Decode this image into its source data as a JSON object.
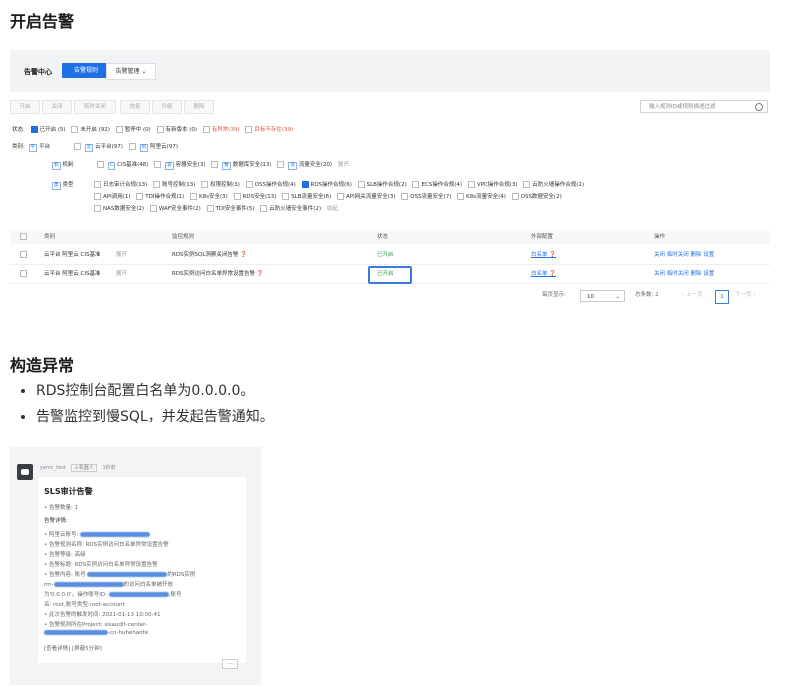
{
  "section1_title": "开启告警",
  "section2_title": "构造异常",
  "bullets": [
    "RDS控制台配置白名单为0.0.0.0。",
    "告警监控到慢SQL，并发起告警通知。"
  ],
  "console": {
    "title": "告警中心",
    "tab_rules": "告警规则",
    "tab_manage": "告警管理",
    "buttons": [
      "开启",
      "关闭",
      "临时关闭",
      "恢复",
      "升级",
      "删除"
    ],
    "search_placeholder": "输入规则ID或规则描述过滤",
    "status_label": "状态:",
    "status_items": [
      "已开启 (5)",
      "未开启 (92)",
      "暂停中 (0)",
      "有新版本 (0)"
    ],
    "status_red": [
      "有异常(39)",
      "目标不存在(39)"
    ],
    "cat_label": "类别:",
    "platform_label": "平台",
    "platform_items": [
      "云平台(97)",
      "阿里云(97)"
    ],
    "mech_label": "机制",
    "mech_items": [
      "CIS基准(48)",
      "容器安全(3)",
      "数据库安全(13)",
      "流量安全(20)"
    ],
    "mech_more": "展开",
    "type_label": "类型",
    "type_row1": [
      "日志审计合规(13)",
      "账号控制(13)",
      "权限控制(3)",
      "OSS操作合规(4)",
      "RDS操作合规(6)",
      "SLB操作合规(2)",
      "ECS操作合规(4)",
      "VPC操作合规(3)",
      "云防火墙操作合规(1)"
    ],
    "type_row2": [
      "API调用(1)",
      "TDI操作合规(1)",
      "K8s安全(3)",
      "RDS安全(13)",
      "SLB流量安全(6)",
      "API网关流量安全(3)",
      "OSS流量安全(7)",
      "K8s流量安全(4)",
      "OSS数据安全(2)"
    ],
    "type_row3": [
      "NAS数据安全(2)",
      "WAF安全事件(2)",
      "TDI安全事件(5)",
      "云防火墙安全事件(2)"
    ],
    "type_more": "收起",
    "table_headers": [
      "类别",
      "监控规则",
      "状态",
      "外部配置",
      "操作"
    ],
    "rows": [
      {
        "cat": "云平台  阿里云  CIS基准",
        "more": "展开",
        "rule": "RDS实例SQL洞察关闭告警",
        "status": "已开启",
        "ext": "白名单",
        "ops": "关闭 临时关闭 删除 设置"
      },
      {
        "cat": "云平台  阿里云  CIS基准",
        "more": "展开",
        "rule": "RDS实例访问白名单异常设置告警",
        "status": "已开启",
        "ext": "白名单",
        "ops": "关闭 临时关闭 删除 设置"
      }
    ],
    "per_page_label": "每页显示:",
    "per_page": "10",
    "total": "总条数: 2",
    "prev": "上一页",
    "page": "1",
    "next": "下一页"
  },
  "notify": {
    "sender": "yemc_test",
    "robot_tag": "机器人",
    "time_tag": "1秒前",
    "title": "SLS审计告警",
    "lines": [
      "• 告警数量: 1",
      "告警详情:",
      "• 阿里云账号:",
      "• 告警规则名称: RDS实例访问白名单异常设置告警",
      "• 告警等级: 高级",
      "• 告警标题: RDS实例访问白名单异常设置告警",
      "• 告警内容: 账号",
      "rm-",
      "为'0.0.0.0'。操作账号ID:",
      "名: root,账号类型:root-account",
      "• 此次告警的触发时间: 2021-01-13 10:00:41",
      "• 告警规则所在Project: slsaudit-center-",
      "-cn-huhehaote",
      "[查看详情] [屏蔽5分钟]"
    ],
    "line_a_tail": "的RDS实例",
    "line_b_tail": "的访问白名单被开放",
    "line_c_tail": ",账号"
  }
}
